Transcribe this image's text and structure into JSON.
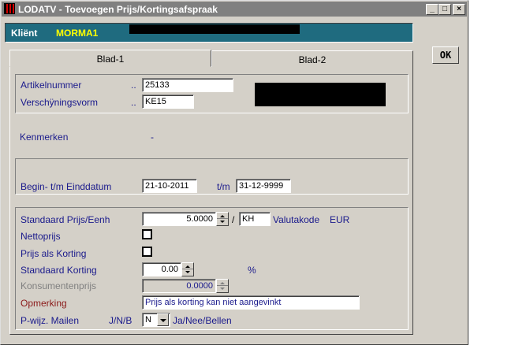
{
  "window": {
    "title": "LODATV - Toevoegen Prijs/Kortingsafspraak",
    "minimize_label": "_",
    "maximize_label": "□",
    "close_label": "×"
  },
  "client": {
    "label": "Kliënt",
    "name": "MORMA1"
  },
  "tabs": [
    {
      "label": "Blad-1"
    },
    {
      "label": "Blad-2"
    }
  ],
  "ok_label": "OK",
  "article": {
    "artikelnummer_label": "Artikelnummer",
    "artikelnummer_dots": "..",
    "artikelnummer_value": "25133",
    "verschijningsvorm_label": "Verschÿningsvorm",
    "verschijningsvorm_dots": "..",
    "verschijningsvorm_value": "KE15"
  },
  "kenmerken": {
    "label": "Kenmerken",
    "value": "-"
  },
  "dates": {
    "label": "Begin- t/m Einddatum",
    "begin_value": "21-10-2011",
    "separator": "t/m",
    "end_value": "31-12-9999"
  },
  "pricing": {
    "prijs_label": "Standaard Prijs/Eenh",
    "prijs_value": "5.0000",
    "slash": "/",
    "eenheid_value": "KH",
    "valuta_label": "Valutakode",
    "valuta_value": "EUR",
    "netto_label": "Nettoprijs",
    "korting_als_label": "Prijs als Korting",
    "std_korting_label": "Standaard Korting",
    "std_korting_value": "0.00",
    "percent": "%",
    "consumenten_label": "Konsumentenprijs",
    "consumenten_value": "0.0000",
    "opmerking_label": "Opmerking",
    "opmerking_value": "Prijs als korting kan niet aangevinkt",
    "mailen_label": "P-wijz. Mailen",
    "mailen_options_label": "J/N/B",
    "mailen_value": "N",
    "mailen_hint": "Ja/Nee/Bellen"
  }
}
